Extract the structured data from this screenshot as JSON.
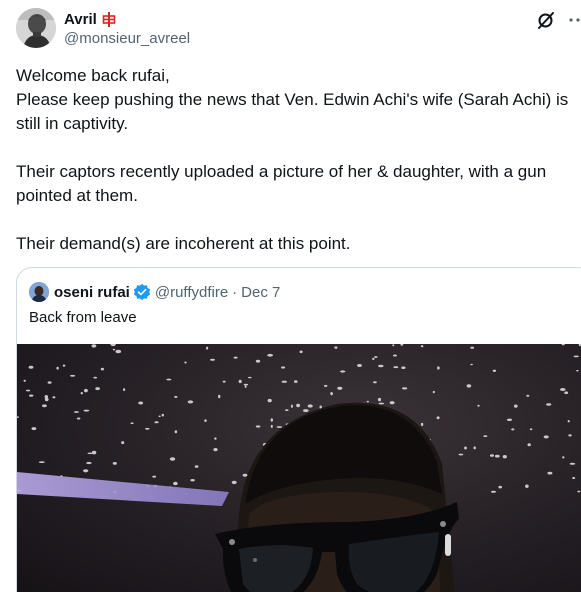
{
  "author": {
    "display_name": "Avril",
    "handle": "@monsieur_avreel"
  },
  "tweet": {
    "line1": "Welcome back rufai,",
    "line2": "Please keep pushing the news that Ven. Edwin Achi's wife (Sarah Achi) is still in captivity.",
    "line3": "Their captors recently uploaded a picture of her & daughter, with a gun pointed at them.",
    "line4": "Their demand(s) are incoherent at this point."
  },
  "quoted": {
    "display_name": "oseni rufai",
    "handle": "@ruffydfire",
    "separator": "·",
    "date": "Dec 7",
    "text": "Back from leave"
  },
  "icons": {
    "flag": "red-cross-flag-icon",
    "grok": "grok-icon",
    "more": "more-icon",
    "verified": "verified-badge-icon"
  },
  "colors": {
    "text": "#0f1419",
    "secondary": "#536471",
    "border": "#cfd9de",
    "verified": "#1d9bf0"
  }
}
